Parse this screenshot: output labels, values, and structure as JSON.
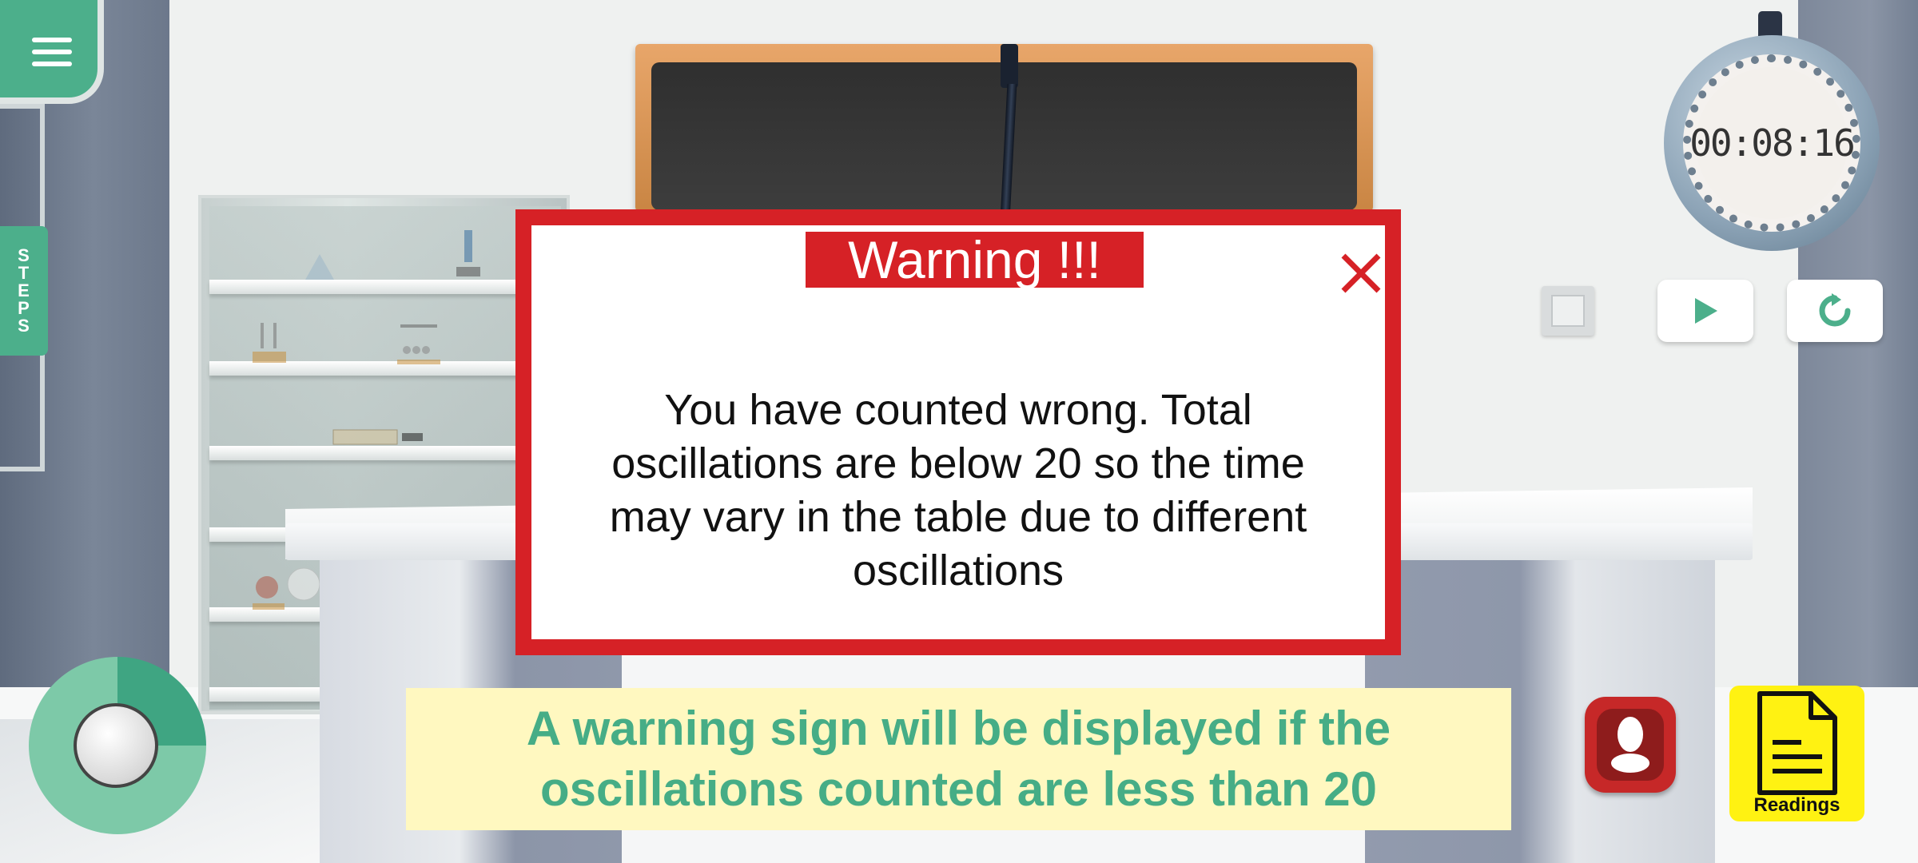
{
  "menu": {
    "icon": "hamburger-menu-icon"
  },
  "steps_tab": {
    "label_letters": [
      "S",
      "T",
      "E",
      "P",
      "S"
    ]
  },
  "stopwatch": {
    "time": "00:08:16"
  },
  "controls": {
    "book_icon": "book-icon",
    "play_icon": "play-icon",
    "reset_icon": "reset-icon"
  },
  "warning_dialog": {
    "title": "Warning !!!",
    "message": "You have counted wrong. Total oscillations are below 20 so the time may vary in the table due to different oscillations",
    "close_icon": "close-icon",
    "accent_color": "#d62126"
  },
  "caption": {
    "text": "A warning sign will be displayed if the oscillations counted are less than 20",
    "color": "#46ad86",
    "background": "#fff8c0"
  },
  "help_button": {
    "icon": "person-icon"
  },
  "readings_button": {
    "label": "Readings",
    "icon": "document-icon"
  },
  "joystick": {
    "icon": "joystick-knob"
  },
  "colors": {
    "brand_green": "#4caf8b",
    "readings_yellow": "#fff212"
  }
}
